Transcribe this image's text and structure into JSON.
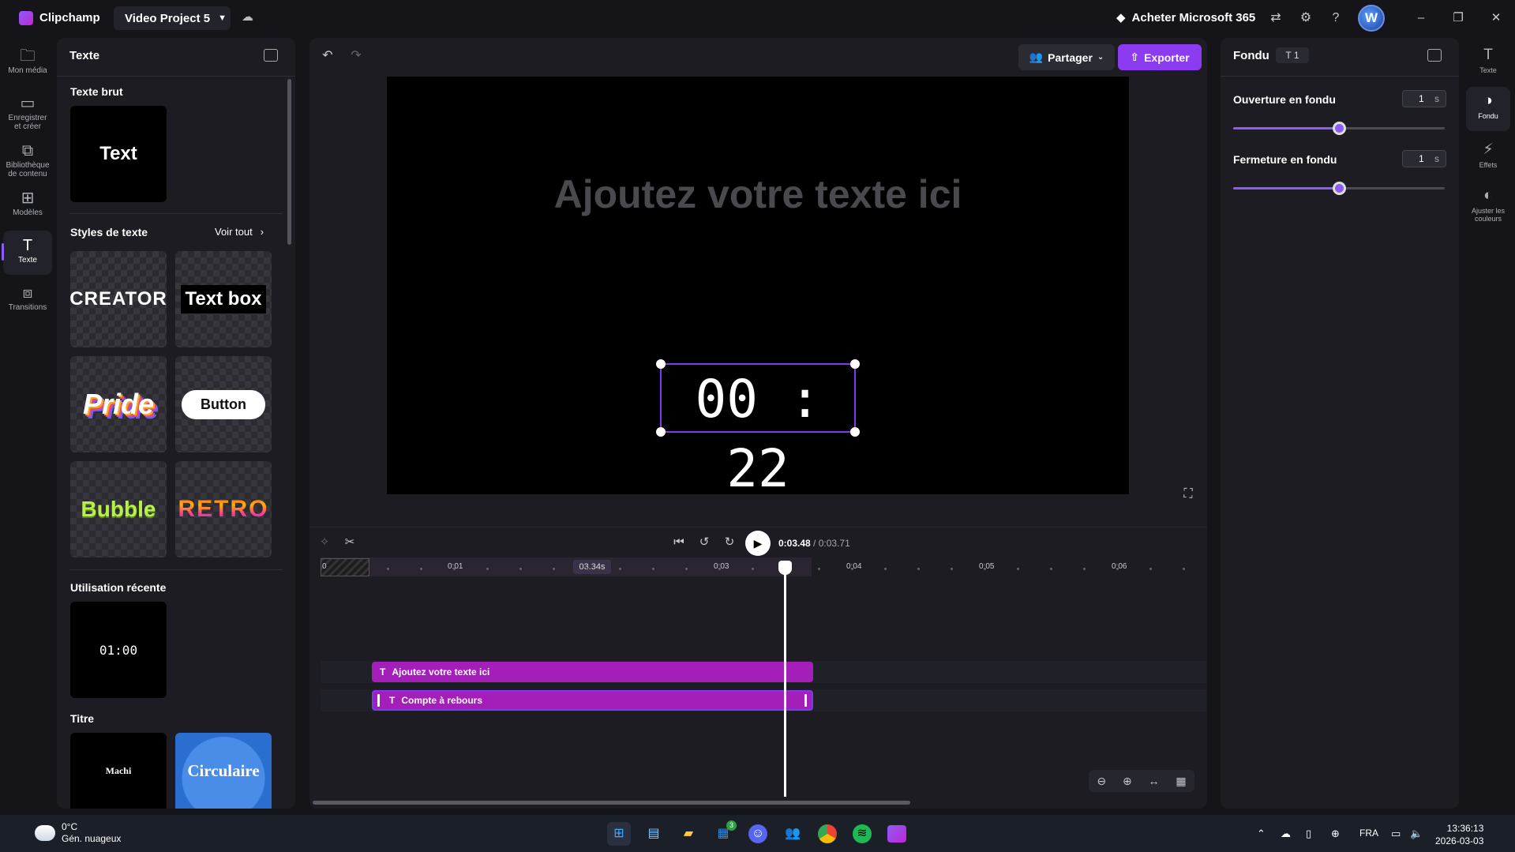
{
  "app": {
    "name": "Clipchamp",
    "project": "Video Project 5",
    "buy": "Acheter Microsoft 365",
    "avatar_letter": "W"
  },
  "leftnav": [
    {
      "label1": "Mon média",
      "label2": "",
      "icon": "folder-icon"
    },
    {
      "label1": "Enregistrer",
      "label2": "et créer",
      "icon": "camera-icon"
    },
    {
      "label1": "Bibliothèque",
      "label2": "de contenu",
      "icon": "library-icon"
    },
    {
      "label1": "Modèles",
      "label2": "",
      "icon": "templates-icon"
    },
    {
      "label1": "Texte",
      "label2": "",
      "icon": "text-icon"
    },
    {
      "label1": "Transitions",
      "label2": "",
      "icon": "transitions-icon"
    }
  ],
  "panel": {
    "title": "Texte",
    "plain_section": "Texte brut",
    "plain_tile": "Text",
    "styles_section": "Styles de texte",
    "see_all": "Voir tout",
    "styles": [
      "CREATOR",
      "Text box",
      "Pride",
      "Button",
      "Bubble",
      "RETRO"
    ],
    "recent_section": "Utilisation récente",
    "recent_tile": "01:00",
    "title_section": "Titre",
    "title_tiles": [
      "Machi",
      "Circulaire"
    ]
  },
  "editor": {
    "share": "Partager",
    "export": "Exporter",
    "placeholder": "Ajoutez votre texte ici",
    "timer": "00 : 22",
    "time_current": "0:03.48",
    "time_total": "/ 0:03.71",
    "ruler_labels": [
      "0",
      "0:01",
      "0:03",
      "0:04",
      "0:05",
      "0:06"
    ],
    "ruler_current": "03.34s",
    "clips": [
      "Ajoutez votre texte ici",
      "Compte à rebours"
    ]
  },
  "rpanel": {
    "title": "Fondu",
    "badge": "1",
    "fade_in_label": "Ouverture en fondu",
    "fade_in_value": "1",
    "fade_out_label": "Fermeture en fondu",
    "fade_out_value": "1",
    "unit": "s",
    "fade_in_fraction": 0.5,
    "fade_out_fraction": 0.5
  },
  "rnav": [
    {
      "label1": "Texte",
      "label2": ""
    },
    {
      "label1": "Fondu",
      "label2": ""
    },
    {
      "label1": "Effets",
      "label2": ""
    },
    {
      "label1": "Ajuster les",
      "label2": "couleurs"
    }
  ],
  "taskbar": {
    "temp": "0°C",
    "weather": "Gén. nuageux",
    "lang": "FRA",
    "time": "13:36:13",
    "date": "2026-03-03",
    "badge": "3"
  },
  "colors": {
    "accent": "#8b5cf6",
    "clip": "#a41fba",
    "export": "#8b3cf0"
  }
}
